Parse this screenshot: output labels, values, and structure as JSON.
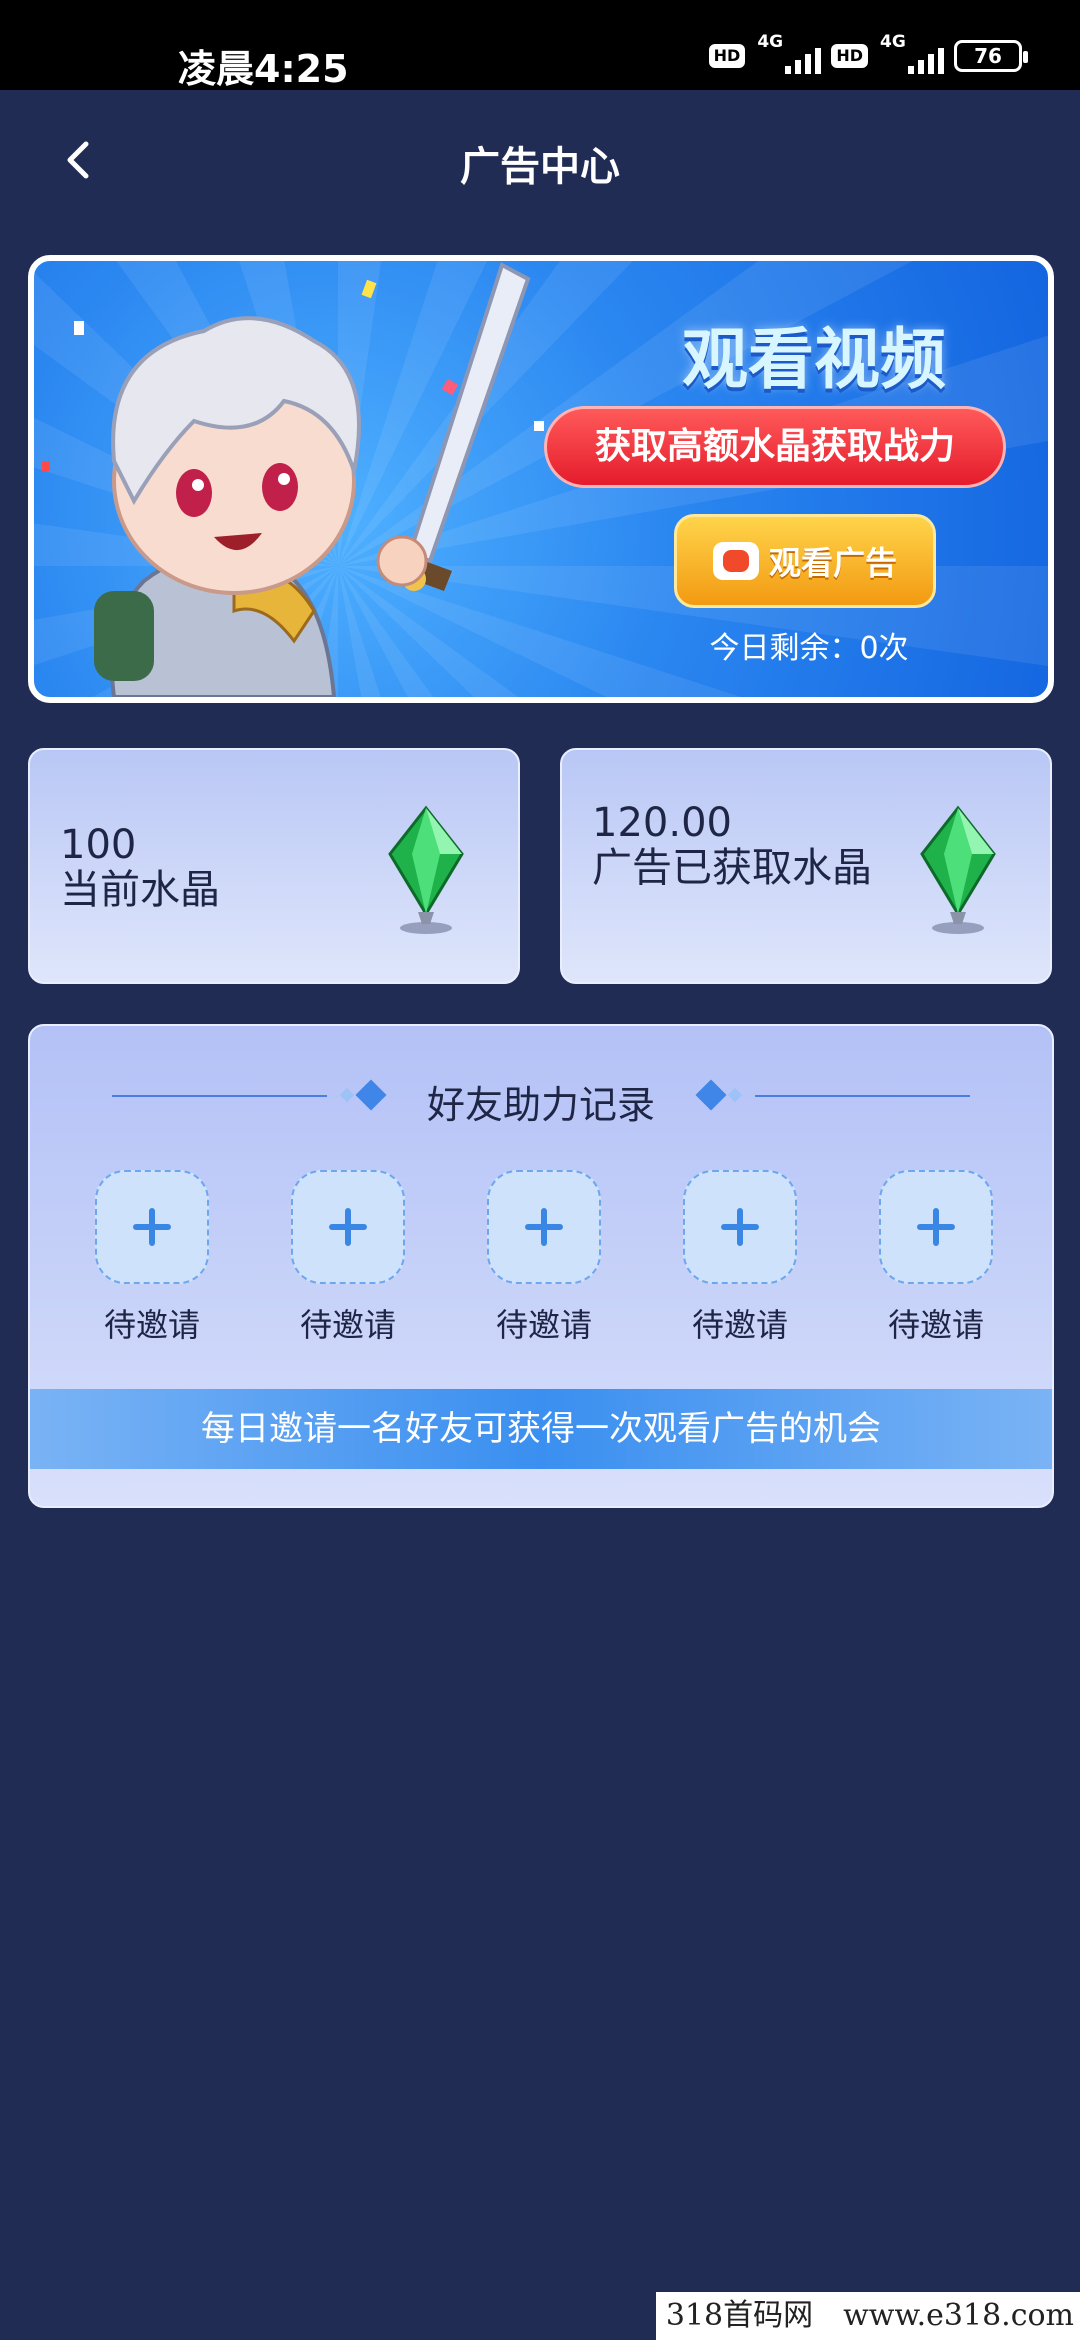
{
  "status_bar": {
    "time": "凌晨4:25",
    "hd_label": "HD",
    "network_label": "4G",
    "battery": "76"
  },
  "header": {
    "title": "广告中心"
  },
  "banner": {
    "title": "观看视频",
    "subtitle": "获取高额水晶获取战力",
    "watch_button": "观看广告",
    "remaining": "今日剩余：0次"
  },
  "stats": [
    {
      "value": "100",
      "label": "当前水晶"
    },
    {
      "value": "120.00",
      "label": "广告已获取水晶"
    }
  ],
  "invite": {
    "title": "好友助力记录",
    "slots": [
      {
        "label": "待邀请"
      },
      {
        "label": "待邀请"
      },
      {
        "label": "待邀请"
      },
      {
        "label": "待邀请"
      },
      {
        "label": "待邀请"
      }
    ],
    "footer": "每日邀请一名好友可获得一次观看广告的机会"
  },
  "watermark": {
    "left": "318首码网",
    "right": "www.e318.com"
  },
  "colors": {
    "background": "#212c54",
    "accent_blue": "#3f86e8",
    "pill_red": "#e51c2c",
    "button_orange": "#f29a12",
    "gem_green": "#1fb24a"
  }
}
